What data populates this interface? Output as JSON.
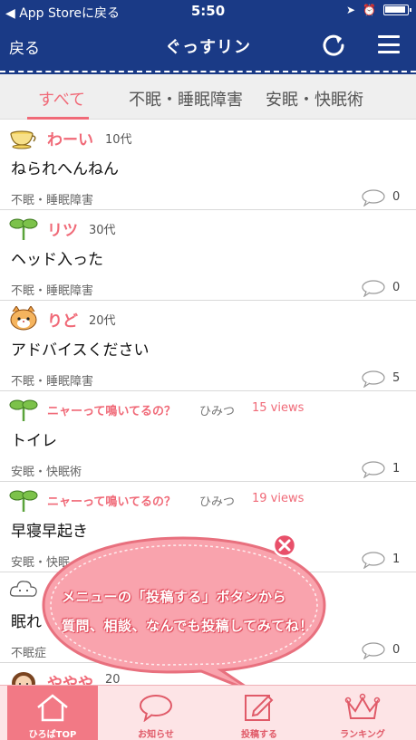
{
  "status_bar": {
    "back_to_app": "◀ App Storeに戻る",
    "time": "5:50"
  },
  "nav": {
    "back_label": "戻る",
    "title": "ぐっすリン"
  },
  "tabs": [
    {
      "label": "すべて",
      "active": true
    },
    {
      "label": "不眠・睡眠障害",
      "active": false
    },
    {
      "label": "安眠・快眠術",
      "active": false
    }
  ],
  "posts": [
    {
      "avatar": "teacup-icon",
      "name": "わーい",
      "age": "10代",
      "body": "ねられへんねん",
      "category": "不眠・睡眠障害",
      "comments": "0"
    },
    {
      "avatar": "sprout-icon",
      "name": "リツ",
      "age": "30代",
      "body": "ヘッド入った",
      "category": "不眠・睡眠障害",
      "comments": "0"
    },
    {
      "avatar": "cat-icon",
      "name": "りど",
      "age": "20代",
      "body": "アドバイスください",
      "category": "不眠・睡眠障害",
      "comments": "5"
    },
    {
      "avatar": "sprout-icon",
      "name": "ニャーって鳴いてるの？",
      "secret": "ひみつ",
      "views": "15 views",
      "body": "トイレ",
      "category": "安眠・快眠術",
      "comments": "1"
    },
    {
      "avatar": "sprout-icon",
      "name": "ニャーって鳴いてるの？",
      "secret": "ひみつ",
      "views": "19 views",
      "body": "早寝早起き",
      "category": "安眠・快眠",
      "comments": "1"
    },
    {
      "avatar": "cloud-icon",
      "name": "",
      "age": "",
      "body": "眠れ",
      "category": "不眠症",
      "comments": "0"
    },
    {
      "avatar": "girl-icon",
      "name": "ややや",
      "age": "20",
      "body": "",
      "category": "",
      "comments": ""
    }
  ],
  "tooltip": {
    "line1": "メニューの「投稿する」ボタンから",
    "line2": "質問、相談、なんでも投稿してみてね！"
  },
  "tabbar": [
    {
      "label": "ひろばTOP",
      "icon": "home-icon",
      "active": true
    },
    {
      "label": "お知らせ",
      "icon": "speech-bubble-icon",
      "active": false
    },
    {
      "label": "投稿する",
      "icon": "compose-icon",
      "active": false
    },
    {
      "label": "ランキング",
      "icon": "crown-icon",
      "active": false
    }
  ],
  "colors": {
    "nav": "#1a3a86",
    "accent": "#f06a78",
    "tabbar": "#fde4e6"
  }
}
